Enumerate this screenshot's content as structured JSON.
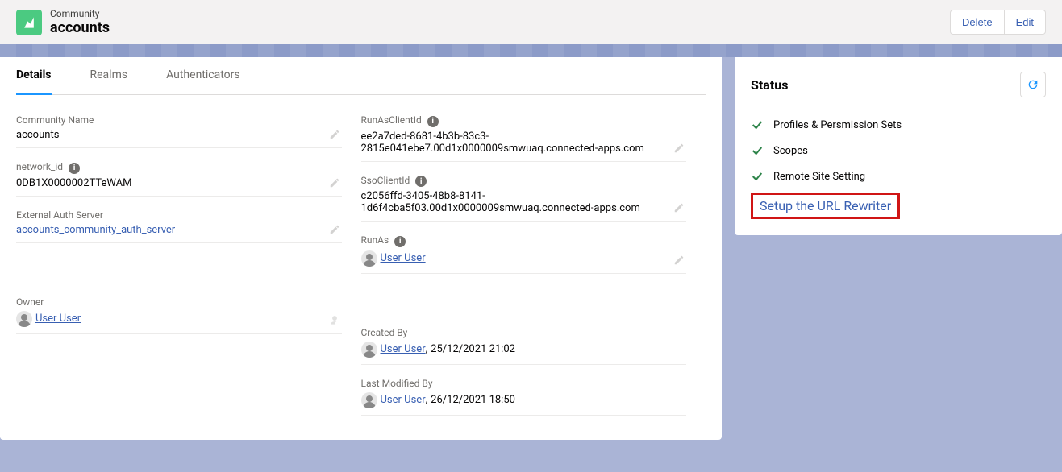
{
  "header": {
    "category": "Community",
    "title": "accounts",
    "delete_label": "Delete",
    "edit_label": "Edit"
  },
  "tabs": {
    "details": "Details",
    "realms": "Realms",
    "authenticators": "Authenticators"
  },
  "left_fields": {
    "community_name": {
      "label": "Community Name",
      "value": "accounts"
    },
    "network_id": {
      "label": "network_id",
      "value": "0DB1X0000002TTeWAM"
    },
    "ext_auth": {
      "label": "External Auth Server",
      "value": "accounts_community_auth_server"
    },
    "owner": {
      "label": "Owner",
      "value": "User User"
    }
  },
  "right_fields": {
    "runas_client": {
      "label": "RunAsClientId",
      "value": "ee2a7ded-8681-4b3b-83c3-2815e041ebe7.00d1x0000009smwuaq.connected-apps.com"
    },
    "sso_client": {
      "label": "SsoClientId",
      "value": "c2056ffd-3405-48b8-8141-1d6f4cba5f03.00d1x0000009smwuaq.connected-apps.com"
    },
    "runas": {
      "label": "RunAs",
      "value": "User User"
    },
    "created": {
      "label": "Created By",
      "user": "User User",
      "ts": "25/12/2021 21:02"
    },
    "modified": {
      "label": "Last Modified By",
      "user": "User User",
      "ts": "26/12/2021 18:50"
    }
  },
  "status": {
    "title": "Status",
    "items": {
      "a": "Profiles & Persmission Sets",
      "b": "Scopes",
      "c": "Remote Site Setting"
    },
    "link": "Setup the URL Rewriter"
  }
}
